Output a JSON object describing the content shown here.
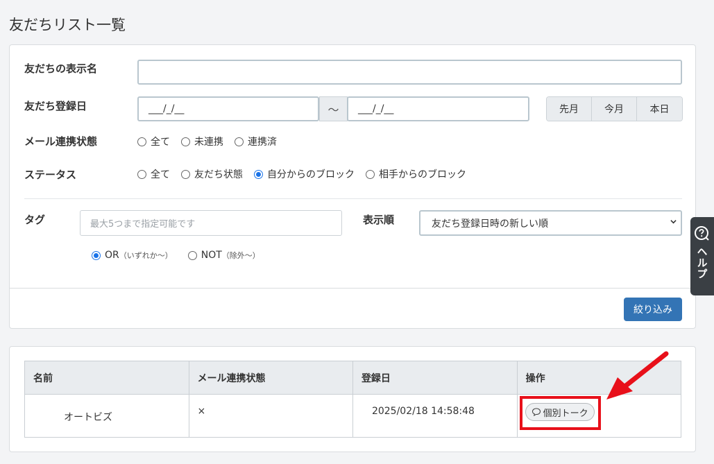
{
  "page": {
    "title": "友だちリスト一覧"
  },
  "filter": {
    "display_name_label": "友だちの表示名",
    "display_name_value": "",
    "register_date_label": "友だち登録日",
    "date_from": "___/_/__",
    "date_sep": "～",
    "date_to": "___/_/__",
    "date_buttons": [
      "先月",
      "今月",
      "本日"
    ],
    "mail_status_label": "メール連携状態",
    "mail_status_options": [
      "全て",
      "未連携",
      "連携済"
    ],
    "status_label": "ステータス",
    "status_options": [
      "全て",
      "友だち状態",
      "自分からのブロック",
      "相手からのブロック"
    ],
    "status_selected": "自分からのブロック",
    "tag_label": "タグ",
    "tag_placeholder": "最大5つまで指定可能です",
    "tag_mode_or": "OR",
    "tag_mode_or_hint": "（いずれか～）",
    "tag_mode_not": "NOT",
    "tag_mode_not_hint": "（除外～）",
    "sort_label": "表示順",
    "sort_value": "友だち登録日時の新しい順",
    "submit_label": "絞り込み"
  },
  "table": {
    "headers": [
      "名前",
      "メール連携状態",
      "登録日",
      "操作"
    ],
    "rows": [
      {
        "name": "オートビズ",
        "mail_status": "×",
        "registered": "2025/02/18 14:58:48",
        "action": "個別トーク"
      }
    ]
  },
  "help": {
    "label": "ヘルプ",
    "icon": "question-icon"
  },
  "colors": {
    "primary": "#3374b5",
    "highlight": "#e8101a",
    "radio_on": "#1a73e8"
  }
}
